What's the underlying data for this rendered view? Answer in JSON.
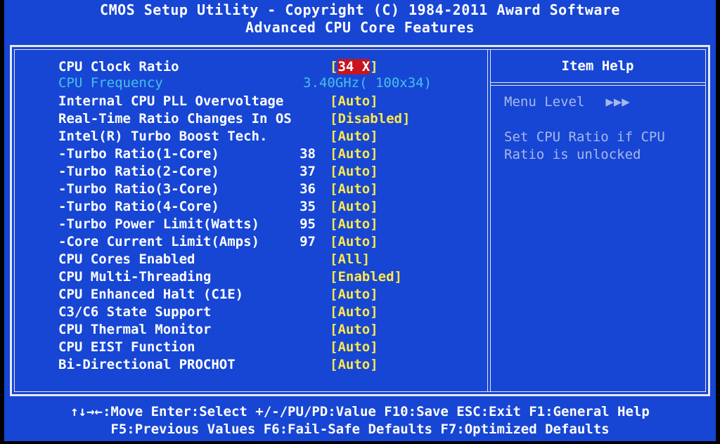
{
  "header": {
    "title": "CMOS Setup Utility - Copyright (C) 1984-2011 Award Software",
    "subtitle": "Advanced CPU Core Features"
  },
  "menu": {
    "items": [
      {
        "label": "CPU Clock Ratio",
        "num": "",
        "value_prefix": "[",
        "value": "34 X",
        "value_suffix": "]",
        "dim": false
      },
      {
        "label": "CPU Frequency",
        "num": "",
        "value": "3.40GHz( 100x34)",
        "dim": true
      },
      {
        "label": "Internal CPU PLL Overvoltage",
        "num": "",
        "value": "[Auto]",
        "dim": false
      },
      {
        "label": "Real-Time Ratio Changes In OS",
        "num": "",
        "value": "[Disabled]",
        "dim": false
      },
      {
        "label": "Intel(R) Turbo Boost Tech.",
        "num": "",
        "value": "[Auto]",
        "dim": false
      },
      {
        "label": "-Turbo Ratio(1-Core)",
        "num": "38",
        "value": "[Auto]",
        "dim": false
      },
      {
        "label": "-Turbo Ratio(2-Core)",
        "num": "37",
        "value": "[Auto]",
        "dim": false
      },
      {
        "label": "-Turbo Ratio(3-Core)",
        "num": "36",
        "value": "[Auto]",
        "dim": false
      },
      {
        "label": "-Turbo Ratio(4-Core)",
        "num": "35",
        "value": "[Auto]",
        "dim": false
      },
      {
        "label": "-Turbo Power Limit(Watts)",
        "num": "95",
        "value": "[Auto]",
        "dim": false
      },
      {
        "label": "-Core Current Limit(Amps)",
        "num": "97",
        "value": "[Auto]",
        "dim": false
      },
      {
        "label": "CPU Cores Enabled",
        "num": "",
        "value": "[All]",
        "dim": false
      },
      {
        "label": "CPU Multi-Threading",
        "num": "",
        "value": "[Enabled]",
        "dim": false
      },
      {
        "label": "CPU Enhanced Halt (C1E)",
        "num": "",
        "value": "[Auto]",
        "dim": false
      },
      {
        "label": "C3/C6 State Support",
        "num": "",
        "value": "[Auto]",
        "dim": false
      },
      {
        "label": "CPU Thermal Monitor",
        "num": "",
        "value": "[Auto]",
        "dim": false
      },
      {
        "label": "CPU EIST Function",
        "num": "",
        "value": "[Auto]",
        "dim": false
      },
      {
        "label": "Bi-Directional PROCHOT",
        "num": "",
        "value": "[Auto]",
        "dim": false
      }
    ]
  },
  "help": {
    "title": "Item Help",
    "menu_level_label": "Menu Level",
    "menu_level_arrows": "▶▶▶",
    "text_line1": "Set CPU Ratio if CPU",
    "text_line2": "Ratio is unlocked"
  },
  "footer": {
    "line1": "↑↓→←:Move  Enter:Select  +/-/PU/PD:Value  F10:Save  ESC:Exit  F1:General Help",
    "line2": "F5:Previous Values  F6:Fail-Safe Defaults  F7:Optimized Defaults"
  },
  "colors": {
    "background": "#1746d4",
    "value": "#ffe94a",
    "dim": "#45c1e8",
    "highlight": "#c8141e"
  }
}
